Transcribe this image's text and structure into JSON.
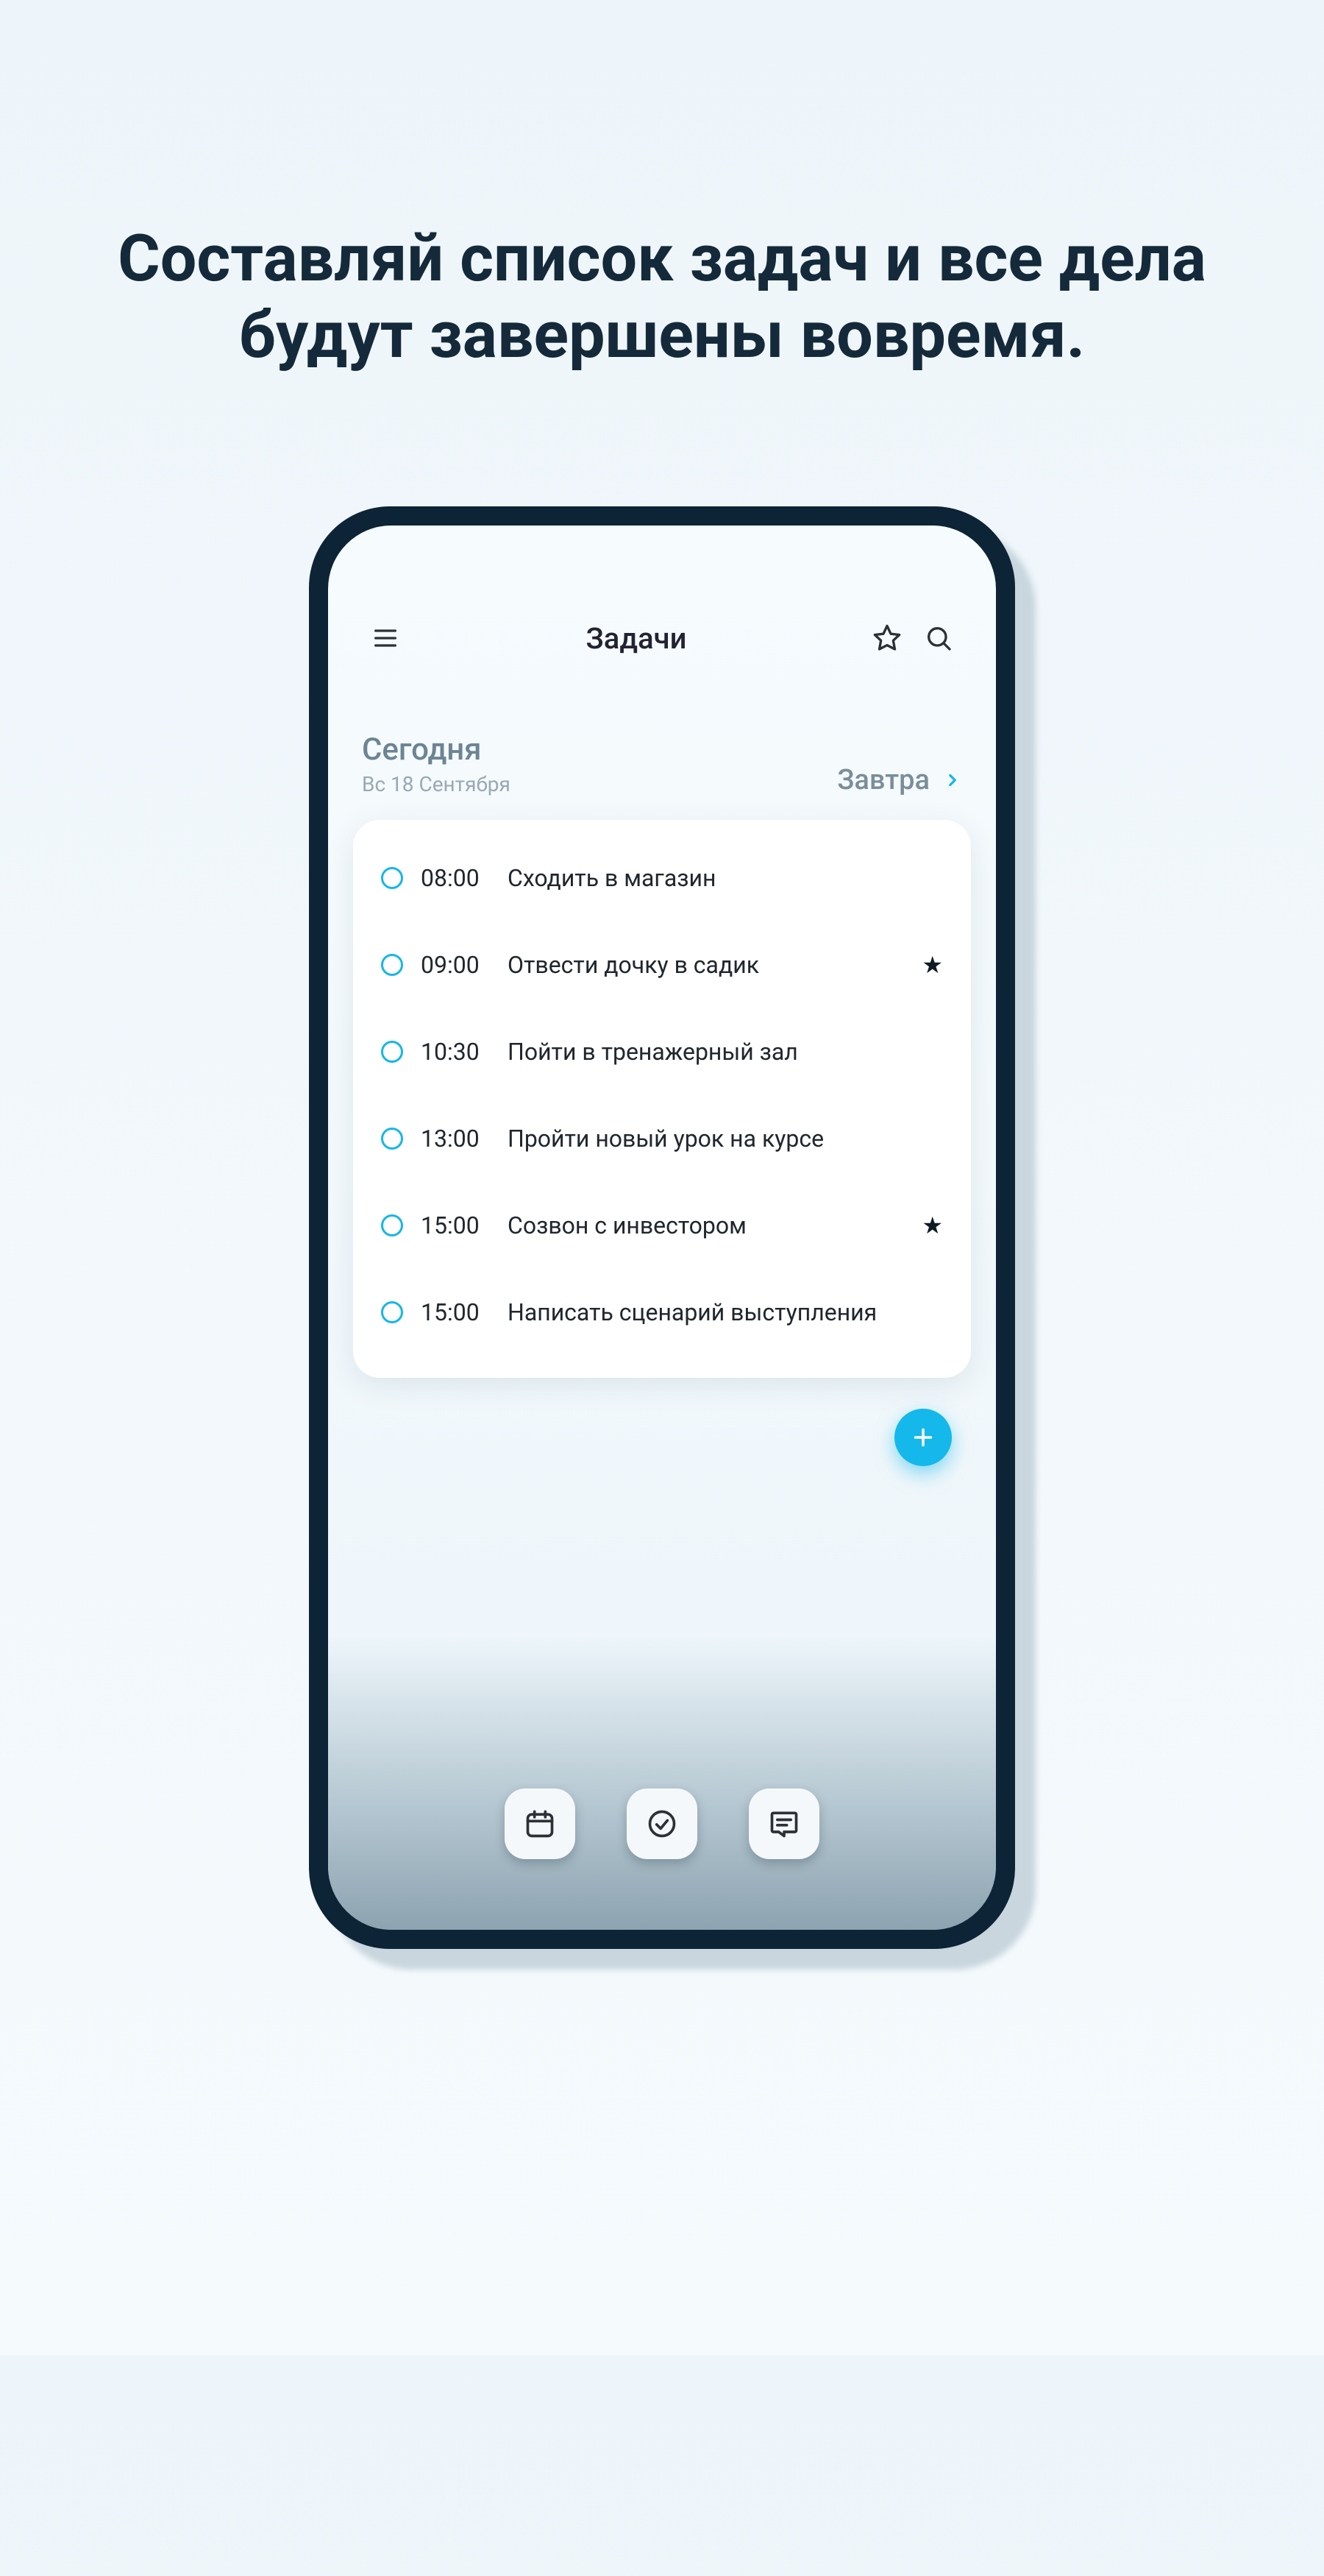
{
  "headline": "Составляй список задач и все дела будут завершены вовремя.",
  "topbar": {
    "title": "Задачи"
  },
  "date": {
    "today_label": "Сегодня",
    "today_date": "Вс 18 Сентября",
    "tomorrow_label": "Завтра"
  },
  "tasks": [
    {
      "time": "08:00",
      "title": "Сходить в магазин",
      "starred": false
    },
    {
      "time": "09:00",
      "title": "Отвести дочку в садик",
      "starred": true
    },
    {
      "time": "10:30",
      "title": "Пойти в тренажерный зал",
      "starred": false
    },
    {
      "time": "13:00",
      "title": "Пройти новый урок на курсе",
      "starred": false
    },
    {
      "time": "15:00",
      "title": "Созвон с инвестором",
      "starred": true
    },
    {
      "time": "15:00",
      "title": "Написать сценарий выступления",
      "starred": false
    }
  ],
  "colors": {
    "accent": "#14b8ea",
    "dark": "#0d2336"
  }
}
